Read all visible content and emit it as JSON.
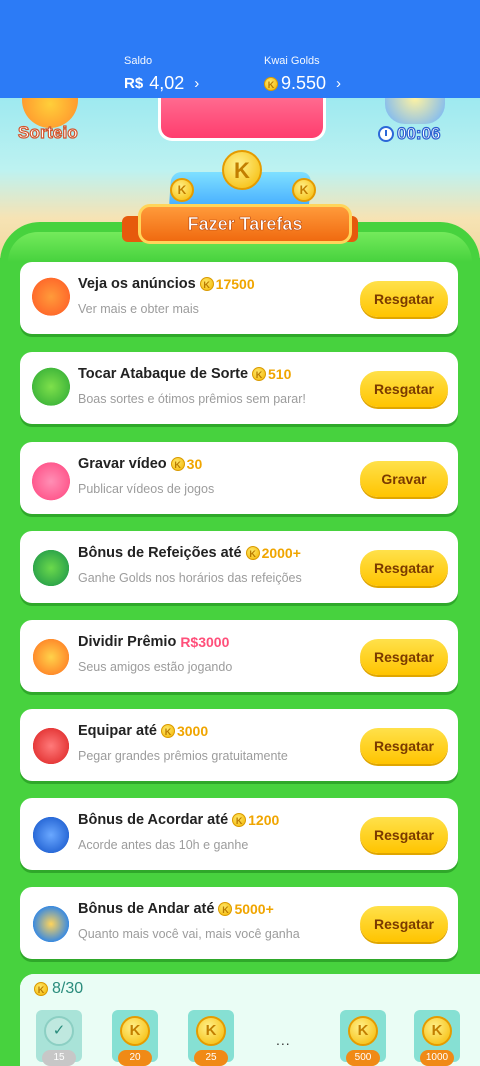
{
  "header": {
    "saldo_label": "Saldo",
    "saldo_currency": "R$",
    "saldo_value": "4,02",
    "golds_label": "Kwai Golds",
    "golds_value": "9.550"
  },
  "banner": {
    "sorteio_label": "Sorteio",
    "timer": "00:06"
  },
  "section_title": "Fazer Tarefas",
  "tasks": [
    {
      "title": "Veja os anúncios",
      "reward": "17500",
      "subtitle": "Ver mais e obter mais",
      "button": "Resgatar",
      "icon": "tv-icon"
    },
    {
      "title": "Tocar Atabaque de Sorte",
      "reward": "510",
      "subtitle": "Boas sortes e ótimos prêmios sem parar!",
      "button": "Resgatar",
      "icon": "drum-icon"
    },
    {
      "title": "Gravar vídeo",
      "reward": "30",
      "subtitle": "Publicar vídeos de jogos",
      "button": "Gravar",
      "icon": "camera-icon"
    },
    {
      "title": "Bônus de Refeições até",
      "reward": "2000+",
      "subtitle": "Ganhe Golds nos horários das refeições",
      "button": "Resgatar",
      "icon": "meal-bag-icon"
    },
    {
      "title": "Dividir Prêmio",
      "reward": "R$3000",
      "subtitle": "Seus amigos estão jogando",
      "button": "Resgatar",
      "icon": "gift-icon"
    },
    {
      "title": "Equipar até",
      "reward": "3000",
      "subtitle": "Pegar grandes prêmios gratuitamente",
      "button": "Resgatar",
      "icon": "boxing-gloves-icon"
    },
    {
      "title": "Bônus de Acordar até",
      "reward": "1200",
      "subtitle": "Acorde antes das 10h e ganhe",
      "button": "Resgatar",
      "icon": "alarm-icon"
    },
    {
      "title": "Bônus de Andar até",
      "reward": "5000+",
      "subtitle": "Quanto mais você vai, mais você ganha",
      "button": "Resgatar",
      "icon": "walking-boy-icon"
    }
  ],
  "progress": {
    "label": "8/30",
    "milestones": [
      {
        "amount": "15",
        "done": true
      },
      {
        "amount": "20",
        "done": false
      },
      {
        "amount": "25",
        "done": false
      },
      {
        "amount": "500",
        "done": false
      },
      {
        "amount": "1000",
        "done": false
      }
    ],
    "ellipsis": "..."
  },
  "colors": {
    "header_blue": "#2c7bf6",
    "panel_green": "#47d23e",
    "button_yellow": "#ffc400",
    "coin_gold": "#f0a500",
    "prize_pink": "#ff4f7a"
  }
}
